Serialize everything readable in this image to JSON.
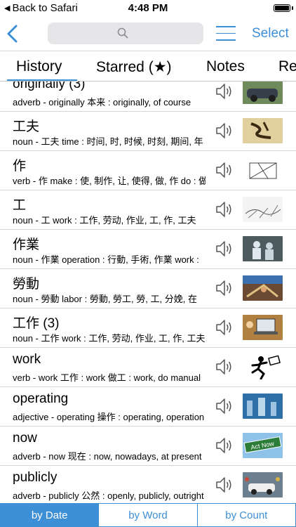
{
  "status_bar": {
    "back_text": "Back to Safari",
    "time": "4:48 PM"
  },
  "nav": {
    "search_placeholder": "",
    "select_label": "Select"
  },
  "tabs": [
    {
      "label": "History",
      "selected": true
    },
    {
      "label": "Starred (★)"
    },
    {
      "label": "Notes"
    },
    {
      "label": "Re"
    }
  ],
  "rows": [
    {
      "title": "originally (3)",
      "subtitle": "adverb  - originally 本来 : originally, of course",
      "image": "vintage-car-photo"
    },
    {
      "title": "工夫",
      "subtitle": "noun  - 工夫 time : 时间, 时, 时候, 时刻, 期间, 年",
      "image": "calligraphy-photo"
    },
    {
      "title": "作",
      "subtitle": "verb  - 作 make : 使, 制作, 让, 使得, 做, 作 do : 做",
      "image": "geometry-diagram"
    },
    {
      "title": "工",
      "subtitle": "noun  - 工 work : 工作, 劳动, 作业, 工, 作, 工夫",
      "image": "sketch-drawing"
    },
    {
      "title": "作業",
      "subtitle": "noun  - 作業 operation : 行動, 手術, 作業 work :",
      "image": "workers-photo"
    },
    {
      "title": "勞動",
      "subtitle": "noun  - 勞動 labor : 勞動, 勞工, 勞, 工, 分娩, 在",
      "image": "tools-photo"
    },
    {
      "title": "工作 (3)",
      "subtitle": "noun  - 工作 work : 工作, 劳动, 作业, 工, 作, 工夫",
      "image": "laptop-desk-photo"
    },
    {
      "title": "work",
      "subtitle": "verb  - work 工作 : work 做工 : work, do manual",
      "image": "running-man-clipart"
    },
    {
      "title": "operating",
      "subtitle": "adjective  - operating 操作 : operating, operation",
      "image": "factory-photo"
    },
    {
      "title": "now",
      "subtitle": "adverb  - now 现在 : now, nowadays, at present",
      "image": "act-now-sign"
    },
    {
      "title": "publicly",
      "subtitle": "adverb  - publicly 公然 : openly, publicly, outright",
      "image": "crowd-car-photo"
    }
  ],
  "segments": [
    {
      "label": "by Date",
      "selected": true
    },
    {
      "label": "by Word"
    },
    {
      "label": "by Count"
    }
  ],
  "colors": {
    "accent": "#3d8fd6",
    "separator": "#d6d6d6"
  }
}
